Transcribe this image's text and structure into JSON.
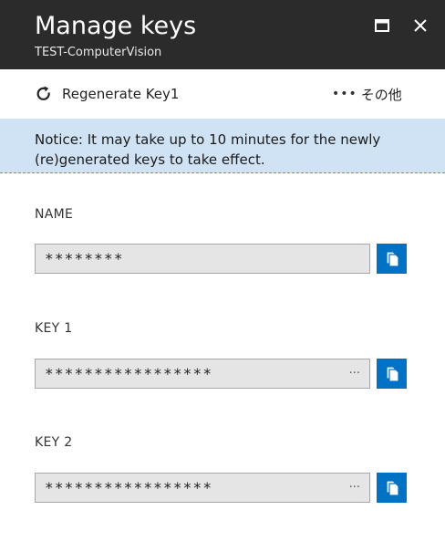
{
  "header": {
    "title": "Manage keys",
    "subtitle": "TEST-ComputerVision",
    "maximize_icon": "maximize-icon",
    "close_icon": "close-icon"
  },
  "toolbar": {
    "regenerate_label": "Regenerate Key1",
    "regenerate_icon": "refresh-icon",
    "more_dots": "•••",
    "more_label": "その他"
  },
  "notice": {
    "text": "Notice: It may take up to 10 minutes for the newly (re)generated keys to take effect."
  },
  "fields": {
    "name": {
      "label": "NAME",
      "value": "********"
    },
    "key1": {
      "label": "KEY 1",
      "value": "*****************",
      "ellipsis": "···"
    },
    "key2": {
      "label": "KEY 2",
      "value": "*****************",
      "ellipsis": "···"
    }
  },
  "colors": {
    "titlebar": "#2b2b2b",
    "notice_bg": "#cfe3f5",
    "accent": "#0072c6"
  }
}
